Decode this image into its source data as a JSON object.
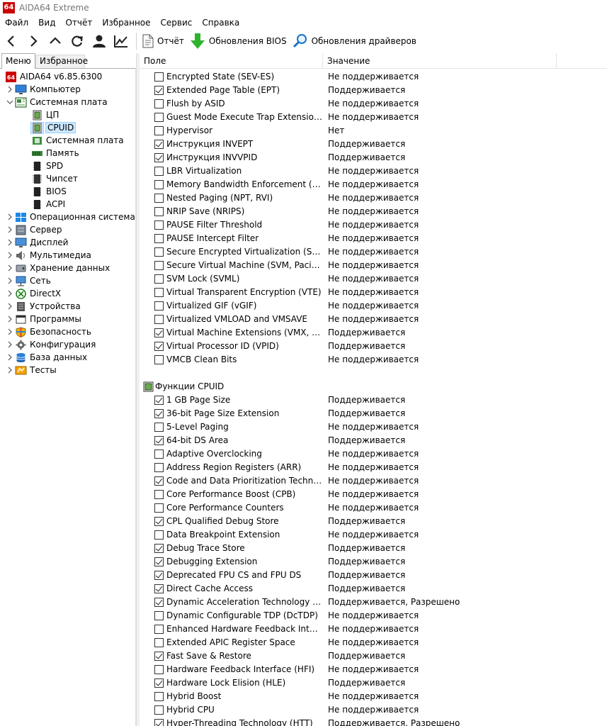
{
  "window": {
    "app_icon_text": "64",
    "title": "AIDA64 Extreme"
  },
  "menubar": [
    "Файл",
    "Вид",
    "Отчёт",
    "Избранное",
    "Сервис",
    "Справка"
  ],
  "toolbar": {
    "report_label": "Отчёт",
    "bios_update_label": "Обновления BIOS",
    "driver_update_label": "Обновления драйверов"
  },
  "tabs": {
    "menu": "Меню",
    "favorites": "Избранное"
  },
  "tree": [
    {
      "label": "AIDA64 v6.85.6300",
      "icon": "aida64-logo-icon",
      "level": 0,
      "chevron": "none"
    },
    {
      "label": "Компьютер",
      "icon": "computer-icon",
      "level": 1,
      "chevron": "right"
    },
    {
      "label": "Системная плата",
      "icon": "motherboard-icon",
      "level": 1,
      "chevron": "down"
    },
    {
      "label": "ЦП",
      "icon": "cpu-icon",
      "level": 2,
      "chevron": "none"
    },
    {
      "label": "CPUID",
      "icon": "cpuid-icon",
      "level": 2,
      "chevron": "none",
      "selected": true
    },
    {
      "label": "Системная плата",
      "icon": "motherboard-chip-icon",
      "level": 2,
      "chevron": "none"
    },
    {
      "label": "Память",
      "icon": "memory-icon",
      "level": 2,
      "chevron": "none"
    },
    {
      "label": "SPD",
      "icon": "spd-icon",
      "level": 2,
      "chevron": "none"
    },
    {
      "label": "Чипсет",
      "icon": "chipset-icon",
      "level": 2,
      "chevron": "none"
    },
    {
      "label": "BIOS",
      "icon": "bios-icon",
      "level": 2,
      "chevron": "none"
    },
    {
      "label": "ACPI",
      "icon": "acpi-icon",
      "level": 2,
      "chevron": "none"
    },
    {
      "label": "Операционная система",
      "icon": "windows-icon",
      "level": 1,
      "chevron": "right"
    },
    {
      "label": "Сервер",
      "icon": "server-icon",
      "level": 1,
      "chevron": "right"
    },
    {
      "label": "Дисплей",
      "icon": "display-icon",
      "level": 1,
      "chevron": "right"
    },
    {
      "label": "Мультимедиа",
      "icon": "speaker-icon",
      "level": 1,
      "chevron": "right"
    },
    {
      "label": "Хранение данных",
      "icon": "storage-icon",
      "level": 1,
      "chevron": "right"
    },
    {
      "label": "Сеть",
      "icon": "network-icon",
      "level": 1,
      "chevron": "right"
    },
    {
      "label": "DirectX",
      "icon": "xbox-icon",
      "level": 1,
      "chevron": "right"
    },
    {
      "label": "Устройства",
      "icon": "devices-icon",
      "level": 1,
      "chevron": "right"
    },
    {
      "label": "Программы",
      "icon": "programs-icon",
      "level": 1,
      "chevron": "right"
    },
    {
      "label": "Безопасность",
      "icon": "shield-icon",
      "level": 1,
      "chevron": "right"
    },
    {
      "label": "Конфигурация",
      "icon": "config-gear-icon",
      "level": 1,
      "chevron": "right"
    },
    {
      "label": "База данных",
      "icon": "database-icon",
      "level": 1,
      "chevron": "right"
    },
    {
      "label": "Тесты",
      "icon": "benchmark-icon",
      "level": 1,
      "chevron": "right"
    }
  ],
  "columns": {
    "field": "Поле",
    "value": "Значение"
  },
  "rows": [
    {
      "field": "Encrypted State (SEV-ES)",
      "value": "Не поддерживается",
      "checked": false
    },
    {
      "field": "Extended Page Table (EPT)",
      "value": "Поддерживается",
      "checked": true
    },
    {
      "field": "Flush by ASID",
      "value": "Не поддерживается",
      "checked": false
    },
    {
      "field": "Guest Mode Execute Trap Extension (G...",
      "value": "Не поддерживается",
      "checked": false
    },
    {
      "field": "Hypervisor",
      "value": "Нет",
      "checked": false
    },
    {
      "field": "Инструкция INVEPT",
      "value": "Поддерживается",
      "checked": true
    },
    {
      "field": "Инструкция INVVPID",
      "value": "Поддерживается",
      "checked": true
    },
    {
      "field": "LBR Virtualization",
      "value": "Не поддерживается",
      "checked": false
    },
    {
      "field": "Memory Bandwidth Enforcement (MBE)",
      "value": "Не поддерживается",
      "checked": false
    },
    {
      "field": "Nested Paging (NPT, RVI)",
      "value": "Не поддерживается",
      "checked": false
    },
    {
      "field": "NRIP Save (NRIPS)",
      "value": "Не поддерживается",
      "checked": false
    },
    {
      "field": "PAUSE Filter Threshold",
      "value": "Не поддерживается",
      "checked": false
    },
    {
      "field": "PAUSE Intercept Filter",
      "value": "Не поддерживается",
      "checked": false
    },
    {
      "field": "Secure Encrypted Virtualization (SEV)",
      "value": "Не поддерживается",
      "checked": false
    },
    {
      "field": "Secure Virtual Machine (SVM, Pacifica)",
      "value": "Не поддерживается",
      "checked": false
    },
    {
      "field": "SVM Lock (SVML)",
      "value": "Не поддерживается",
      "checked": false
    },
    {
      "field": "Virtual Transparent Encryption (VTE)",
      "value": "Не поддерживается",
      "checked": false
    },
    {
      "field": "Virtualized GIF (vGIF)",
      "value": "Не поддерживается",
      "checked": false
    },
    {
      "field": "Virtualized VMLOAD and VMSAVE",
      "value": "Не поддерживается",
      "checked": false
    },
    {
      "field": "Virtual Machine Extensions (VMX, Vand...",
      "value": "Поддерживается",
      "checked": true
    },
    {
      "field": "Virtual Processor ID (VPID)",
      "value": "Поддерживается",
      "checked": true
    },
    {
      "field": "VMCB Clean Bits",
      "value": "Не поддерживается",
      "checked": false
    }
  ],
  "group2": {
    "label": "Функции CPUID",
    "rows": [
      {
        "field": "1 GB Page Size",
        "value": "Поддерживается",
        "checked": true
      },
      {
        "field": "36-bit Page Size Extension",
        "value": "Поддерживается",
        "checked": true
      },
      {
        "field": "5-Level Paging",
        "value": "Не поддерживается",
        "checked": false
      },
      {
        "field": "64-bit DS Area",
        "value": "Поддерживается",
        "checked": true
      },
      {
        "field": "Adaptive Overclocking",
        "value": "Не поддерживается",
        "checked": false
      },
      {
        "field": "Address Region Registers (ARR)",
        "value": "Не поддерживается",
        "checked": false
      },
      {
        "field": "Code and Data Prioritization Technolog...",
        "value": "Не поддерживается",
        "checked": true
      },
      {
        "field": "Core Performance Boost (CPB)",
        "value": "Не поддерживается",
        "checked": false
      },
      {
        "field": "Core Performance Counters",
        "value": "Не поддерживается",
        "checked": false
      },
      {
        "field": "CPL Qualified Debug Store",
        "value": "Поддерживается",
        "checked": true
      },
      {
        "field": "Data Breakpoint Extension",
        "value": "Не поддерживается",
        "checked": false
      },
      {
        "field": "Debug Trace Store",
        "value": "Поддерживается",
        "checked": true
      },
      {
        "field": "Debugging Extension",
        "value": "Поддерживается",
        "checked": true
      },
      {
        "field": "Deprecated FPU CS and FPU DS",
        "value": "Поддерживается",
        "checked": true
      },
      {
        "field": "Direct Cache Access",
        "value": "Поддерживается",
        "checked": true
      },
      {
        "field": "Dynamic Acceleration Technology (IDA)",
        "value": "Поддерживается, Разрешено",
        "checked": true
      },
      {
        "field": "Dynamic Configurable TDP (DcTDP)",
        "value": "Не поддерживается",
        "checked": false
      },
      {
        "field": "Enhanced Hardware Feedback Interface ...",
        "value": "Не поддерживается",
        "checked": false
      },
      {
        "field": "Extended APIC Register Space",
        "value": "Не поддерживается",
        "checked": false
      },
      {
        "field": "Fast Save & Restore",
        "value": "Поддерживается",
        "checked": true
      },
      {
        "field": "Hardware Feedback Interface (HFI)",
        "value": "Не поддерживается",
        "checked": false
      },
      {
        "field": "Hardware Lock Elision (HLE)",
        "value": "Поддерживается",
        "checked": true
      },
      {
        "field": "Hybrid Boost",
        "value": "Не поддерживается",
        "checked": false
      },
      {
        "field": "Hybrid CPU",
        "value": "Не поддерживается",
        "checked": false
      },
      {
        "field": "Hyper-Threading Technology (HTT)",
        "value": "Поддерживается, Разрешено",
        "checked": true
      }
    ]
  },
  "colors": {
    "selection_bg": "#cce8ff",
    "green_arrow": "#2fb32f",
    "aida_red": "#cc0000",
    "chip_green": "#3d8c3d"
  }
}
